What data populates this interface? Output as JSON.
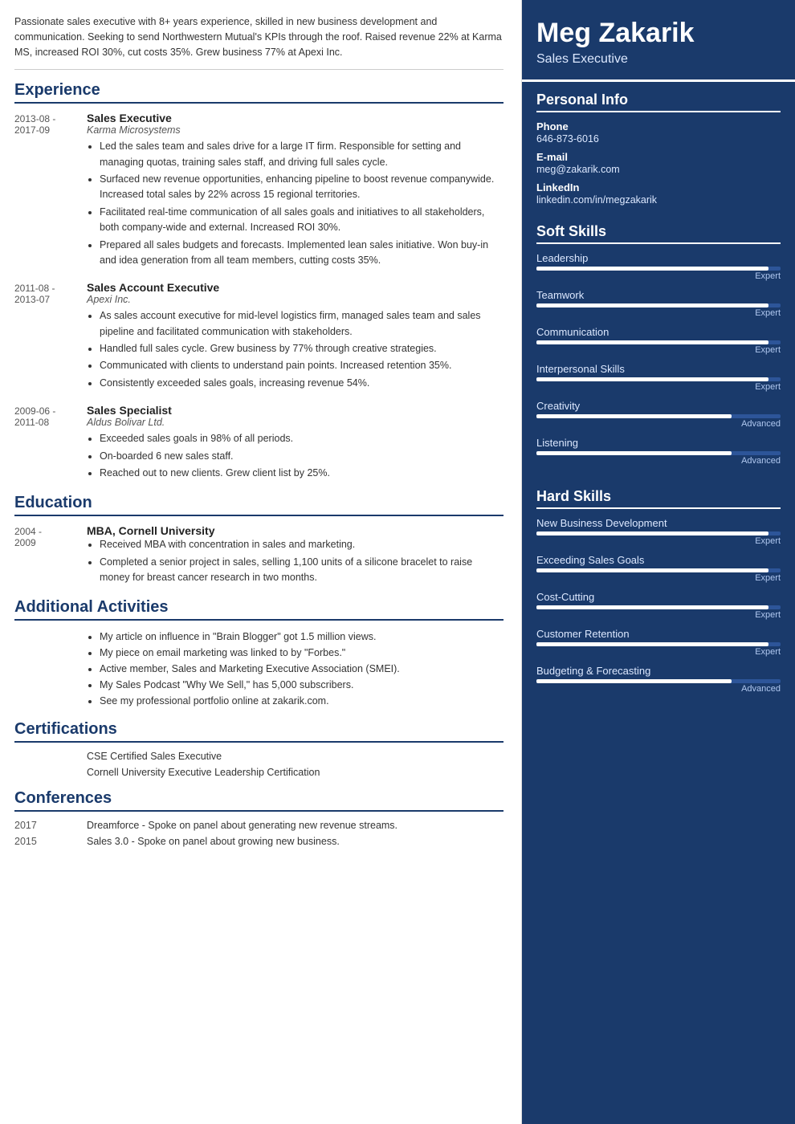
{
  "left": {
    "summary": "Passionate sales executive with 8+ years experience, skilled in new business development and communication. Seeking to send Northwestern Mutual's KPIs through the roof. Raised revenue 22% at Karma MS, increased ROI 30%, cut costs 35%. Grew business 77% at Apexi Inc.",
    "sections": {
      "experience": {
        "label": "Experience",
        "jobs": [
          {
            "dates": "2013-08 -\n2017-09",
            "title": "Sales Executive",
            "company": "Karma Microsystems",
            "bullets": [
              "Led the sales team and sales drive for a large IT firm. Responsible for setting and managing quotas, training sales staff, and driving full sales cycle.",
              "Surfaced new revenue opportunities, enhancing pipeline to boost revenue companywide. Increased total sales by 22% across 15 regional territories.",
              "Facilitated real-time communication of all sales goals and initiatives to all stakeholders, both company-wide and external. Increased ROI 30%.",
              "Prepared all sales budgets and forecasts. Implemented lean sales initiative. Won buy-in and idea generation from all team members, cutting costs 35%."
            ]
          },
          {
            "dates": "2011-08 -\n2013-07",
            "title": "Sales Account Executive",
            "company": "Apexi Inc.",
            "bullets": [
              "As sales account executive for mid-level logistics firm, managed sales team and sales pipeline and facilitated communication with stakeholders.",
              "Handled full sales cycle. Grew business by 77% through creative strategies.",
              "Communicated with clients to understand pain points. Increased retention 35%.",
              "Consistently exceeded sales goals, increasing revenue 54%."
            ]
          },
          {
            "dates": "2009-06 -\n2011-08",
            "title": "Sales Specialist",
            "company": "Aldus Bolivar Ltd.",
            "bullets": [
              "Exceeded sales goals in 98% of all periods.",
              "On-boarded 6 new sales staff.",
              "Reached out to new clients. Grew client list by 25%."
            ]
          }
        ]
      },
      "education": {
        "label": "Education",
        "items": [
          {
            "dates": "2004 -\n2009",
            "title": "MBA, Cornell University",
            "bullets": [
              "Received MBA with concentration in sales and marketing.",
              "Completed a senior project in sales, selling 1,100 units of a silicone bracelet to raise money for breast cancer research in two months."
            ]
          }
        ]
      },
      "additional": {
        "label": "Additional Activities",
        "bullets": [
          "My article on influence in \"Brain Blogger\" got 1.5 million views.",
          "My piece on email marketing was linked to by \"Forbes.\"",
          "Active member, Sales and Marketing Executive Association (SMEI).",
          "My Sales Podcast \"Why We Sell,\" has 5,000 subscribers.",
          "See my professional portfolio online at zakarik.com."
        ]
      },
      "certifications": {
        "label": "Certifications",
        "items": [
          "CSE Certified Sales Executive",
          "Cornell University Executive Leadership Certification"
        ]
      },
      "conferences": {
        "label": "Conferences",
        "items": [
          {
            "year": "2017",
            "desc": "Dreamforce - Spoke on panel about generating new revenue streams."
          },
          {
            "year": "2015",
            "desc": "Sales 3.0 - Spoke on panel about growing new business."
          }
        ]
      }
    }
  },
  "right": {
    "name": "Meg Zakarik",
    "jobtitle": "Sales Executive",
    "personalInfo": {
      "label": "Personal Info",
      "fields": [
        {
          "label": "Phone",
          "value": "646-873-6016"
        },
        {
          "label": "E-mail",
          "value": "meg@zakarik.com"
        },
        {
          "label": "LinkedIn",
          "value": "linkedin.com/in/megzakarik"
        }
      ]
    },
    "softSkills": {
      "label": "Soft Skills",
      "skills": [
        {
          "name": "Leadership",
          "level": "Expert",
          "pct": 95
        },
        {
          "name": "Teamwork",
          "level": "Expert",
          "pct": 95
        },
        {
          "name": "Communication",
          "level": "Expert",
          "pct": 95
        },
        {
          "name": "Interpersonal Skills",
          "level": "Expert",
          "pct": 95
        },
        {
          "name": "Creativity",
          "level": "Advanced",
          "pct": 80
        },
        {
          "name": "Listening",
          "level": "Advanced",
          "pct": 80
        }
      ]
    },
    "hardSkills": {
      "label": "Hard Skills",
      "skills": [
        {
          "name": "New Business Development",
          "level": "Expert",
          "pct": 95
        },
        {
          "name": "Exceeding Sales Goals",
          "level": "Expert",
          "pct": 95
        },
        {
          "name": "Cost-Cutting",
          "level": "Expert",
          "pct": 95
        },
        {
          "name": "Customer Retention",
          "level": "Expert",
          "pct": 95
        },
        {
          "name": "Budgeting & Forecasting",
          "level": "Advanced",
          "pct": 80
        }
      ]
    }
  }
}
